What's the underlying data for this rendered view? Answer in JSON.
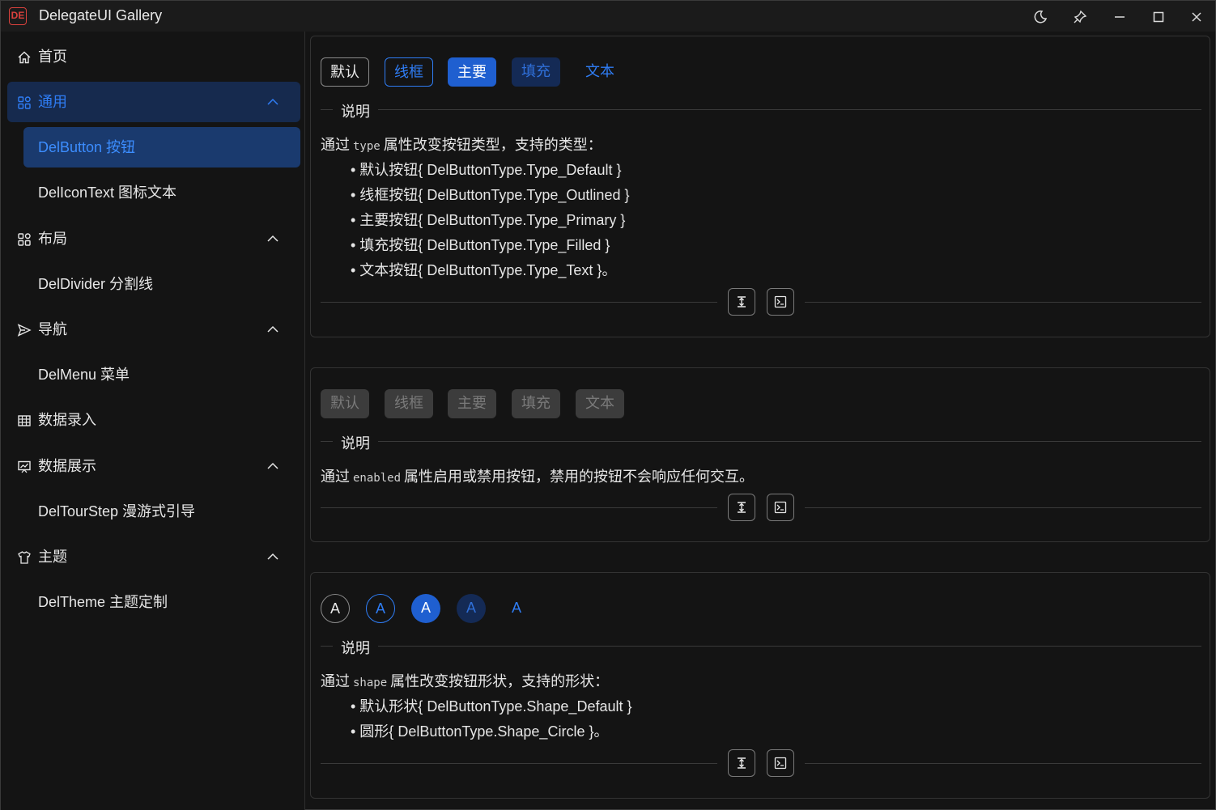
{
  "window": {
    "title": "DelegateUI Gallery",
    "controls": [
      "moon-icon",
      "pin-icon",
      "minimize-icon",
      "maximize-icon",
      "close-icon"
    ]
  },
  "sidebar": {
    "items": [
      {
        "label": "首页",
        "icon": "home-icon"
      },
      {
        "label": "通用",
        "icon": "appstore-icon",
        "expanded": true,
        "active": true
      },
      {
        "label": "DelButton 按钮",
        "active": true
      },
      {
        "label": "DelIconText 图标文本"
      },
      {
        "label": "布局",
        "icon": "appstore-icon",
        "expanded": true
      },
      {
        "label": "DelDivider 分割线"
      },
      {
        "label": "导航",
        "icon": "send-icon",
        "expanded": true
      },
      {
        "label": "DelMenu 菜单"
      },
      {
        "label": "数据录入",
        "icon": "table-icon"
      },
      {
        "label": "数据展示",
        "icon": "chart-icon",
        "expanded": true
      },
      {
        "label": "DelTourStep 漫游式引导"
      },
      {
        "label": "主题",
        "icon": "shirt-icon",
        "expanded": true
      },
      {
        "label": "DelTheme 主题定制"
      }
    ]
  },
  "colors": {
    "accent": "#2f7df5",
    "primary_bg": "#1f5fd0",
    "filled_bg": "#142a55",
    "background": "#141414"
  },
  "cards": [
    {
      "buttons": [
        "默认",
        "线框",
        "主要",
        "填充",
        "文本"
      ],
      "section_label": "说明",
      "desc_prefix": "通过",
      "desc_code": "type",
      "desc_suffix": "属性改变按钮类型，支持的类型：",
      "bullets": [
        "• 默认按钮{ DelButtonType.Type_Default }",
        "• 线框按钮{ DelButtonType.Type_Outlined }",
        "• 主要按钮{ DelButtonType.Type_Primary }",
        "• 填充按钮{ DelButtonType.Type_Filled }",
        "• 文本按钮{ DelButtonType.Type_Text }。"
      ]
    },
    {
      "buttons": [
        "默认",
        "线框",
        "主要",
        "填充",
        "文本"
      ],
      "section_label": "说明",
      "desc_prefix": "通过",
      "desc_code": "enabled",
      "desc_suffix": "属性启用或禁用按钮，禁用的按钮不会响应任何交互。",
      "bullets": []
    },
    {
      "buttons": [
        "A",
        "A",
        "A",
        "A",
        "A"
      ],
      "section_label": "说明",
      "desc_prefix": "通过",
      "desc_code": "shape",
      "desc_suffix": "属性改变按钮形状，支持的形状：",
      "bullets": [
        "• 默认形状{ DelButtonType.Shape_Default }",
        "• 圆形{ DelButtonType.Shape_Circle }。"
      ]
    }
  ]
}
